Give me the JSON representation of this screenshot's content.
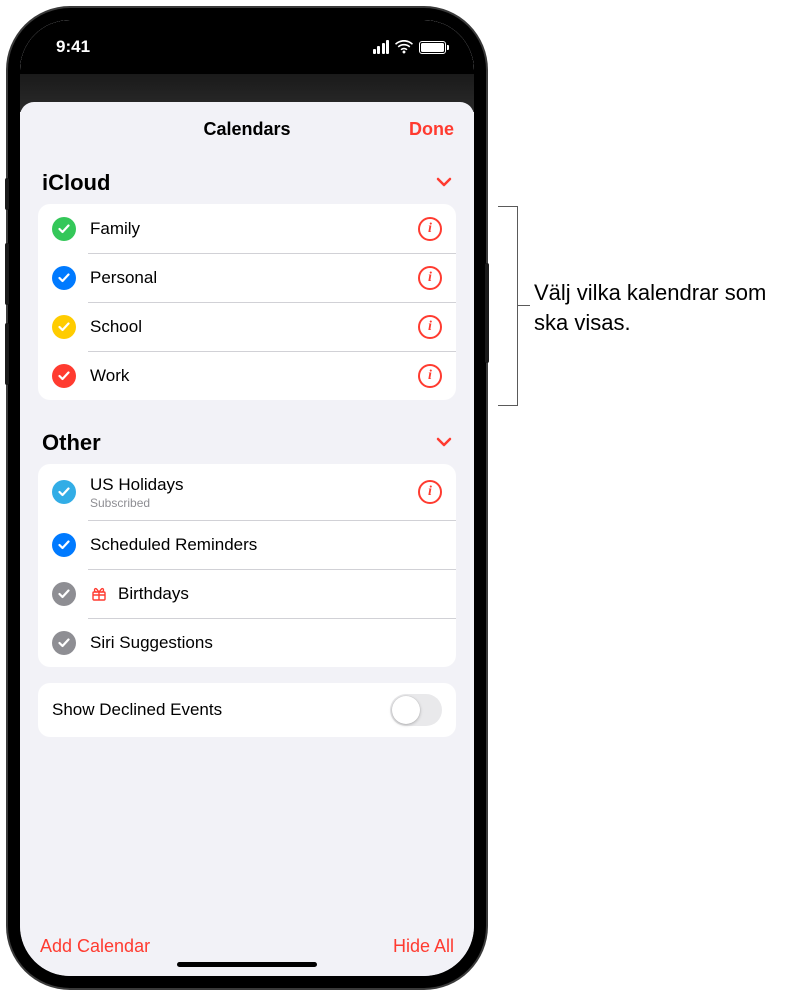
{
  "status": {
    "time": "9:41"
  },
  "nav": {
    "title": "Calendars",
    "done": "Done"
  },
  "sections": [
    {
      "title": "iCloud",
      "items": [
        {
          "label": "Family",
          "color": "#34c759",
          "info": true
        },
        {
          "label": "Personal",
          "color": "#007aff",
          "info": true
        },
        {
          "label": "School",
          "color": "#ffcc00",
          "info": true
        },
        {
          "label": "Work",
          "color": "#ff3b30",
          "info": true
        }
      ]
    },
    {
      "title": "Other",
      "items": [
        {
          "label": "US Holidays",
          "sub": "Subscribed",
          "color": "#32ade6",
          "info": true
        },
        {
          "label": "Scheduled Reminders",
          "color": "#007aff",
          "info": false
        },
        {
          "label": "Birthdays",
          "color": "#8e8e93",
          "info": false,
          "icon": "gift"
        },
        {
          "label": "Siri Suggestions",
          "color": "#8e8e93",
          "info": false
        }
      ]
    }
  ],
  "toggle": {
    "label": "Show Declined Events",
    "on": false
  },
  "footer": {
    "add": "Add Calendar",
    "hide": "Hide All"
  },
  "callout": {
    "text": "Välj vilka kalendrar som ska visas."
  }
}
